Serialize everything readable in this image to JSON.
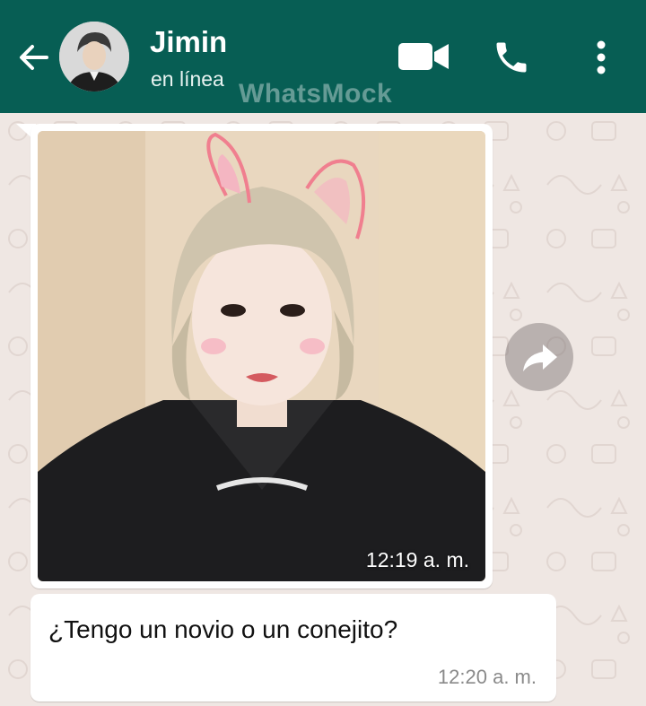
{
  "header": {
    "contact_name": "Jimin",
    "status": "en línea",
    "watermark": "WhatsMock"
  },
  "icons": {
    "back": "arrow-back-icon",
    "video": "video-call-icon",
    "phone": "voice-call-icon",
    "more": "more-vert-icon",
    "forward": "forward-icon"
  },
  "messages": [
    {
      "type": "image",
      "time": "12:19 a. m."
    },
    {
      "type": "text",
      "text": "¿Tengo un novio o un conejito?",
      "time": "12:20 a. m."
    }
  ],
  "colors": {
    "header": "#075e54",
    "bubble": "#ffffff",
    "wallpaper": "#efe7e3"
  }
}
